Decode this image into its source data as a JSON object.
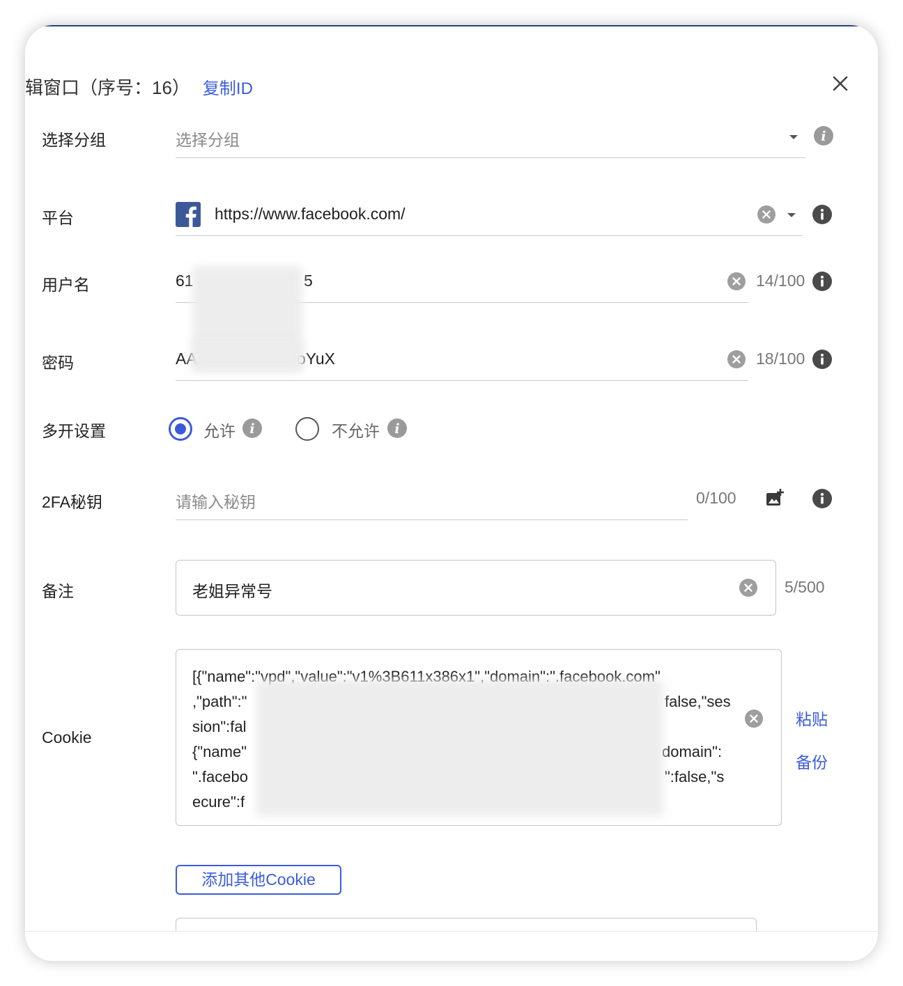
{
  "dialog": {
    "title": "辑窗口（序号：16）",
    "copy_id_label": "复制ID"
  },
  "group": {
    "label": "选择分组",
    "placeholder": "选择分组"
  },
  "platform": {
    "label": "平台",
    "value": "https://www.facebook.com/",
    "icon": "facebook-icon"
  },
  "username": {
    "label": "用户名",
    "value_start": "61",
    "value_end": "5",
    "counter": "14/100"
  },
  "password": {
    "label": "密码",
    "value_start": "AA",
    "value_end": "oYuX",
    "counter": "18/100"
  },
  "multi_open": {
    "label": "多开设置",
    "options": [
      "允许",
      "不允许"
    ],
    "selected": "允许"
  },
  "twofa": {
    "label": "2FA秘钥",
    "placeholder": "请输入秘钥",
    "counter": "0/100"
  },
  "note": {
    "label": "备注",
    "value": "老姐异常号",
    "counter": "5/500"
  },
  "cookie": {
    "label": "Cookie",
    "lines": [
      "[{\"name\":\"vpd\",\"value\":\"v1%3B611x386x1\",\"domain\":\".facebook.com\"",
      ",\"path\":\"",
      "false,\"ses",
      "sion\":fal",
      "{\"name\"",
      "domain\":",
      "\".facebo",
      "\":false,\"s",
      "ecure\":f"
    ],
    "paste_label": "粘贴",
    "backup_label": "备份"
  },
  "add_cookie_label": "添加其他Cookie",
  "colors": {
    "accent": "#3b5bdb",
    "facebook": "#3b5998"
  }
}
